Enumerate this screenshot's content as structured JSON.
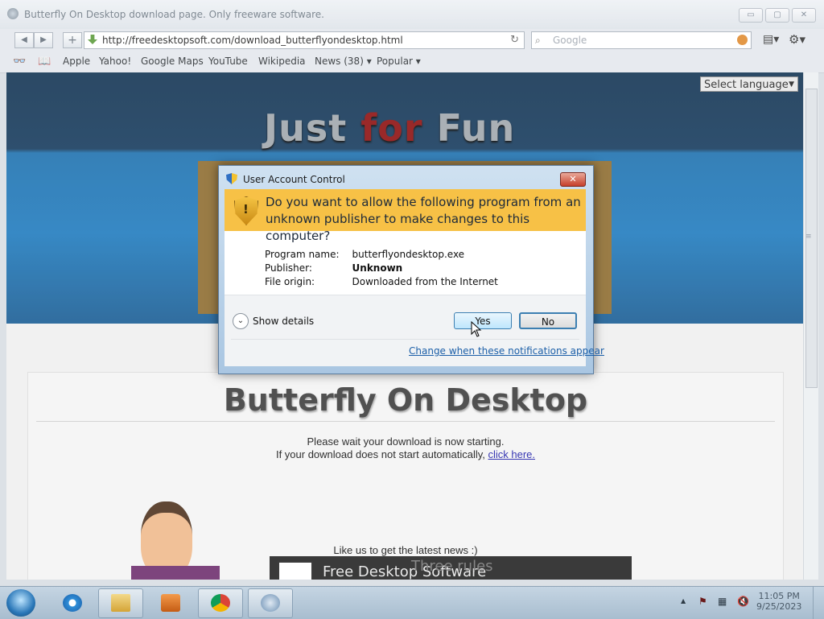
{
  "window": {
    "title": "Butterfly On Desktop download page. Only freeware software.",
    "minimize_glyph": "▭",
    "maximize_glyph": "▢",
    "close_glyph": "✕"
  },
  "toolbar": {
    "back_glyph": "◀",
    "forward_glyph": "▶",
    "add_glyph": "+",
    "url": "http://freedesktopsoft.com/download_butterflyondesktop.html",
    "reload_glyph": "↻",
    "search_placeholder": "Google",
    "page_menu_glyph": "▤▾",
    "settings_glyph": "⚙▾"
  },
  "bookmarks": {
    "items": [
      "Apple",
      "Yahoo!",
      "Google Maps",
      "YouTube",
      "Wikipedia",
      "News (38) ▾",
      "Popular ▾"
    ]
  },
  "page": {
    "select_language": "Select language",
    "select_arrow": "▼",
    "hero_word1": "Just",
    "hero_word2": "for",
    "hero_word3": "Fun",
    "heading": "Butterfly On Desktop",
    "wait_message": "Please wait your download is now starting.",
    "fallback_message": "If your download does not start automatically,",
    "click_here": "click here.",
    "like_us": "Like us to get the latest news :)",
    "fb_page_name": "Free Desktop Software",
    "fb_overlay": "Three rules"
  },
  "uac": {
    "title": "User Account Control",
    "close_glyph": "✕",
    "question": "Do you want to allow the following program from an unknown publisher to make changes to this computer?",
    "fields": [
      {
        "label": "Program name:",
        "value": "butterflyondesktop.exe",
        "bold": false
      },
      {
        "label": "Publisher:",
        "value": "Unknown",
        "bold": true
      },
      {
        "label": "File origin:",
        "value": "Downloaded from the Internet",
        "bold": false
      }
    ],
    "show_details": "Show details",
    "details_glyph": "⌄",
    "yes_label": "Yes",
    "no_label": "No",
    "notify_link": "Change when these notifications appear"
  },
  "taskbar": {
    "time": "11:05 PM",
    "date": "9/25/2023"
  }
}
